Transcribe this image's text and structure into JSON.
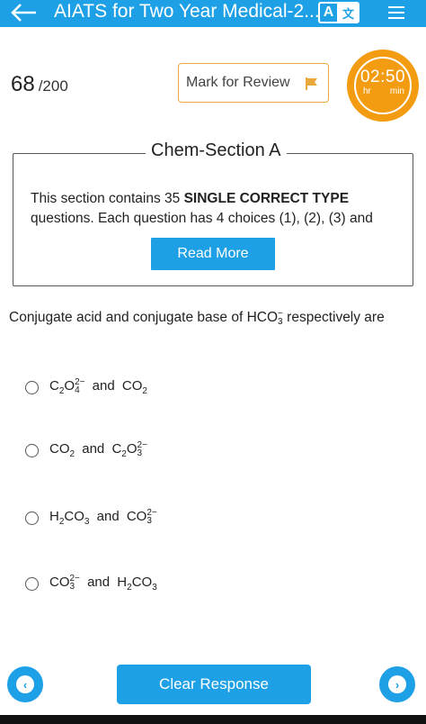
{
  "appbar": {
    "title": "AIATS for Two Year Medical-2...",
    "translate_a": "A",
    "translate_b": "文",
    "colors": {
      "primary": "#1ea0e6"
    }
  },
  "score": {
    "value": "68",
    "total": "/200"
  },
  "review": {
    "label": "Mark for Review",
    "flag_color": "#e8a93a"
  },
  "timer": {
    "time": "02:50",
    "hr": "hr",
    "min": "min",
    "color": "#f39c12"
  },
  "section": {
    "title": "Chem-Section A",
    "desc_prefix": "This section contains 35 ",
    "desc_bold": "SINGLE CORRECT TYPE",
    "desc_suffix": " questions. Each question has 4 choices (1), (2), (3) and",
    "read_more": "Read More"
  },
  "question": {
    "prefix": "Conjugate acid and conjugate base of ",
    "ion_base": "HCO",
    "ion_sub": "3",
    "ion_sup": "−",
    "suffix": " respectively are"
  },
  "options": [
    {
      "a": "C",
      "a_sub1": "2",
      "a2": "O",
      "a_sub2": "4",
      "a_sup": "2−",
      "and": "and",
      "b": "CO",
      "b_sub": "2"
    },
    {
      "a": "CO",
      "a_sub": "2",
      "and": "and",
      "b": "C",
      "b_sub1": "2",
      "b2": "O",
      "b_sub2": "3",
      "b_sup": "2−"
    },
    {
      "a": "H",
      "a_sub1": "2",
      "a2": "CO",
      "a_sub2": "3",
      "and": "and",
      "b": "CO",
      "b_sub": "3",
      "b_sup": "2−"
    },
    {
      "a": "CO",
      "a_sub": "3",
      "a_sup": "2−",
      "and": "and",
      "b": "H",
      "b_sub1": "2",
      "b2": "CO",
      "b_sub2": "3"
    }
  ],
  "bottom": {
    "clear_label": "Clear Response",
    "prev_icon": "chevron-left-icon",
    "next_icon": "chevron-right-icon"
  }
}
